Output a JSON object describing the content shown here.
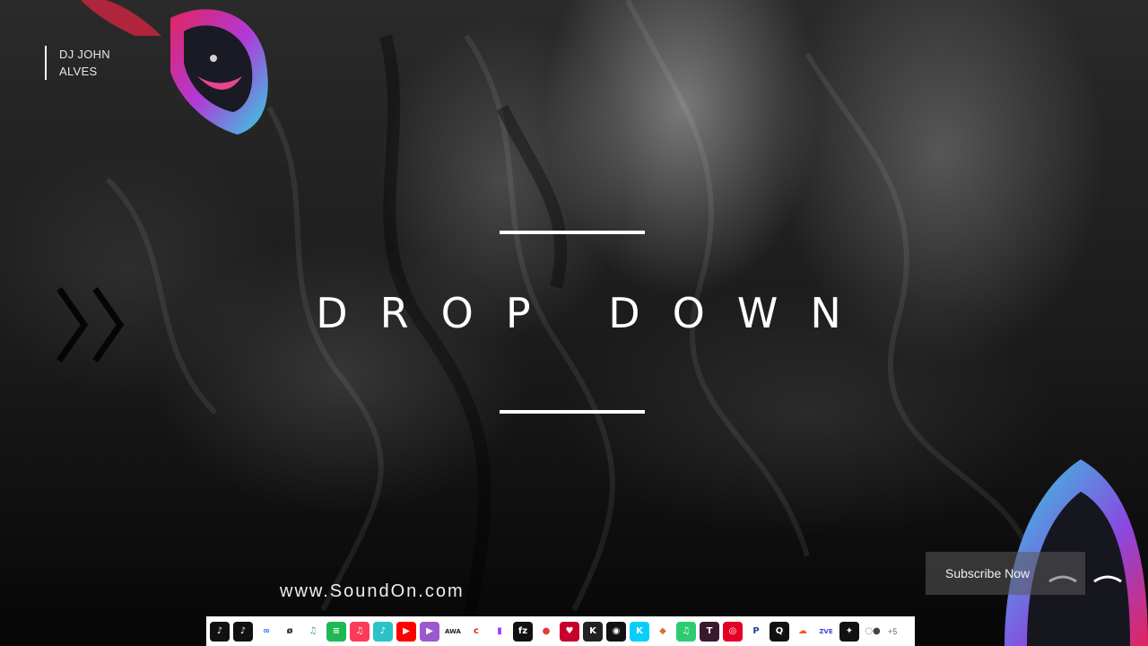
{
  "brand": {
    "line1": "DJ JOHN",
    "line2": "ALVES"
  },
  "title": "DROP DOWN",
  "website": "www.SoundOn.com",
  "subscribe_label": "Subscribe Now",
  "dock": {
    "more_label": "+5",
    "apps": [
      {
        "icon": "tiktok-icon",
        "glyph": "♪",
        "color": "#111111"
      },
      {
        "icon": "tiktok-icon",
        "glyph": "♪",
        "color": "#111111"
      },
      {
        "icon": "meta-icon",
        "glyph": "∞",
        "color": "#ffffff",
        "fg": "#1877f2"
      },
      {
        "icon": "pandora-like-icon",
        "glyph": "ø",
        "color": "#ffffff",
        "fg": "#222222"
      },
      {
        "icon": "music-note-icon",
        "glyph": "♫",
        "color": "#ffffff",
        "fg": "#3aa675"
      },
      {
        "icon": "spotify-icon",
        "glyph": "≡",
        "color": "#1db954"
      },
      {
        "icon": "apple-music-icon",
        "glyph": "♫",
        "color": "#fa3c58"
      },
      {
        "icon": "amazon-music-icon",
        "glyph": "♪",
        "color": "#2bc3c7"
      },
      {
        "icon": "youtube-icon",
        "glyph": "▶",
        "color": "#ff0000"
      },
      {
        "icon": "youtube-music-icon",
        "glyph": "▶",
        "color": "#9b59d0"
      },
      {
        "icon": "awa-icon",
        "glyph": "AWA",
        "color": "#ffffff",
        "fg": "#222222"
      },
      {
        "icon": "claro-musica-icon",
        "glyph": "c",
        "color": "#ffffff",
        "fg": "#e2231a"
      },
      {
        "icon": "deezer-icon",
        "glyph": "▮",
        "color": "#ffffff",
        "fg": "#a238ff"
      },
      {
        "icon": "fizy-icon",
        "glyph": "fz",
        "color": "#111111"
      },
      {
        "icon": "genre-icon",
        "glyph": "●",
        "color": "#ffffff",
        "fg": "#e53935"
      },
      {
        "icon": "iheartradio-icon",
        "glyph": "♥",
        "color": "#c6002b"
      },
      {
        "icon": "kkbox-icon",
        "glyph": "K",
        "color": "#222222"
      },
      {
        "icon": "boomplay-icon",
        "glyph": "◉",
        "color": "#111111"
      },
      {
        "icon": "kkbox-blue-icon",
        "glyph": "K",
        "color": "#09cefb"
      },
      {
        "icon": "anghami-icon",
        "glyph": "◆",
        "color": "#ffffff",
        "fg": "#e06b2f"
      },
      {
        "icon": "music-app-icon",
        "glyph": "♫",
        "color": "#2ecc71"
      },
      {
        "icon": "music-store-icon",
        "glyph": "T",
        "color": "#3b1a2f"
      },
      {
        "icon": "netease-icon",
        "glyph": "◎",
        "color": "#e60026"
      },
      {
        "icon": "pandora-icon",
        "glyph": "P",
        "color": "#ffffff",
        "fg": "#224099"
      },
      {
        "icon": "qobuz-icon",
        "glyph": "Q",
        "color": "#111111"
      },
      {
        "icon": "soundcloud-icon",
        "glyph": "☁",
        "color": "#ffffff",
        "fg": "#ff5500"
      },
      {
        "icon": "tidal-like-icon",
        "glyph": "ZVE",
        "color": "#ffffff",
        "fg": "#3a47d5"
      },
      {
        "icon": "tidal-icon",
        "glyph": "✦",
        "color": "#111111"
      },
      {
        "icon": "other-icon",
        "glyph": "◌●",
        "color": "#ffffff",
        "fg": "#444444"
      }
    ]
  }
}
